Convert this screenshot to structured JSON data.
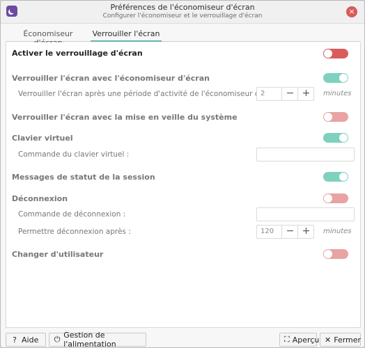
{
  "window": {
    "title": "Préférences de l'économiseur d'écran",
    "subtitle": "Configurer l'économiseur et le verrouillage d'écran",
    "close_icon": "×"
  },
  "tabs": [
    {
      "label": "Économiseur d'écran",
      "active": false
    },
    {
      "label": "Verrouiller l'écran",
      "active": true
    }
  ],
  "lock": {
    "enable_label": "Activer le verrouillage d'écran",
    "enable_state": "off",
    "with_saver_label": "Verrouiller l'écran avec l'économiseur d'écran",
    "with_saver_state": "on",
    "delay_label": "Verrouiller l'écran après une période d'activité de l'économiseur d'écran de :",
    "delay_value": "2",
    "delay_units": "minutes",
    "with_sleep_label": "Verrouiller l'écran avec la mise en veille du système",
    "with_sleep_state": "off",
    "keyboard_label": "Clavier virtuel",
    "keyboard_state": "on",
    "keyboard_cmd_label": "Commande du clavier virtuel :",
    "keyboard_cmd_value": "",
    "status_label": "Messages de statut de la session",
    "status_state": "on",
    "logout_label": "Déconnexion",
    "logout_state": "off",
    "logout_cmd_label": "Commande de déconnexion :",
    "logout_cmd_value": "",
    "logout_after_label": "Permettre déconnexion après :",
    "logout_after_value": "120",
    "logout_after_units": "minutes",
    "switch_user_label": "Changer d'utilisateur",
    "switch_user_state": "off"
  },
  "spin_symbols": {
    "minus": "−",
    "plus": "+"
  },
  "footer": {
    "help_icon": "?",
    "help_label": "Aide",
    "power_icon": "⏻",
    "power_label": "Gestion de l'alimentation",
    "preview_icon": "⛶",
    "preview_label": "Aperçu",
    "close_icon": "✕",
    "close_label": "Fermer"
  },
  "colors": {
    "toggle_off": "#d95c5c",
    "toggle_off_disabled": "#e8a3a3",
    "toggle_on": "#7fd0bf",
    "tab_accent": "#5fb8a8",
    "app_icon": "#6a4aa0"
  }
}
